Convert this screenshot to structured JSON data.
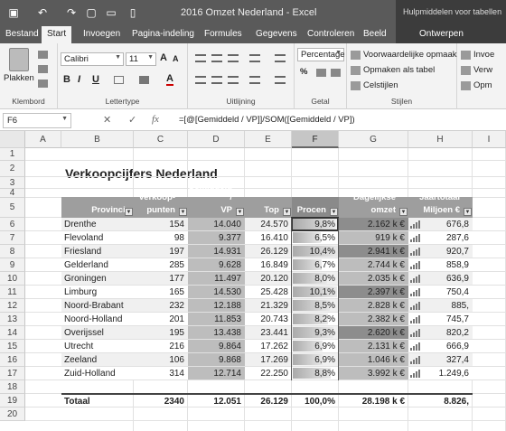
{
  "window": {
    "title": "2016 Omzet Nederland  -  Excel",
    "context_group": "Hulpmiddelen voor tabellen"
  },
  "quick_access": [
    "save-icon",
    "undo-icon",
    "redo-icon",
    "new-icon",
    "open-icon",
    "print-preview-icon"
  ],
  "tabs": [
    "Bestand",
    "Start",
    "Invoegen",
    "Pagina-indeling",
    "Formules",
    "Gegevens",
    "Controleren",
    "Beeld"
  ],
  "active_tab": "Start",
  "context_tab": "Ontwerpen",
  "ribbon": {
    "clipboard": {
      "paste": "Plakken",
      "label": "Klembord"
    },
    "font": {
      "name": "Calibri",
      "size": "11",
      "label": "Lettertype",
      "bold": "B",
      "italic": "I",
      "underline": "U",
      "grow": "A",
      "shrink": "A",
      "fill": "A"
    },
    "alignment": {
      "label": "Uitlijning"
    },
    "number": {
      "format": "Percentage",
      "label": "Getal",
      "percent": "%"
    },
    "styles": {
      "cond": "Voorwaardelijke opmaak",
      "table": "Opmaken als tabel",
      "cell": "Celstijlen",
      "label": "Stijlen"
    },
    "cells": {
      "insert": "Invoe",
      "delete": "Verw",
      "format": "Opm"
    }
  },
  "formula_bar": {
    "name_box": "F6",
    "fx": "fx",
    "cancel": "✕",
    "enter": "✓",
    "formula": "=[@[Gemiddeld / VP]]/SOM([Gemiddeld / VP])"
  },
  "columns": [
    "A",
    "B",
    "C",
    "D",
    "E",
    "F",
    "G",
    "H",
    "I"
  ],
  "selected_column": "F",
  "rows": [
    "1",
    "2",
    "3",
    "4",
    "5",
    "6",
    "7",
    "8",
    "9",
    "10",
    "11",
    "12",
    "13",
    "14",
    "15",
    "16",
    "17",
    "18",
    "19",
    "20"
  ],
  "sheet_title": "Verkoopcijfers Nederland",
  "headers": {
    "provincie": "Provincie",
    "verkooppunten": [
      "Verkoop-",
      "punten"
    ],
    "gemiddeld": [
      "Gemiddeld /",
      "VP"
    ],
    "top": "Top",
    "procent": "Procen",
    "dagelijkse": [
      "Dagelijkse",
      "omzet"
    ],
    "jaartotaal": [
      "Jaartotaal",
      "Miljoen €"
    ]
  },
  "table": [
    {
      "provincie": "Drenthe",
      "vp": "154",
      "gem": "14.040",
      "top": "24.570",
      "pct": "9,8%",
      "pct_value": 9.8,
      "dag": "2.162 k €",
      "jaar": "676,8"
    },
    {
      "provincie": "Flevoland",
      "vp": "98",
      "gem": "9.377",
      "top": "16.410",
      "pct": "6,5%",
      "pct_value": 6.5,
      "dag": "919 k €",
      "jaar": "287,6"
    },
    {
      "provincie": "Friesland",
      "vp": "197",
      "gem": "14.931",
      "top": "26.129",
      "pct": "10,4%",
      "pct_value": 10.4,
      "dag": "2.941 k €",
      "jaar": "920,7"
    },
    {
      "provincie": "Gelderland",
      "vp": "285",
      "gem": "9.628",
      "top": "16.849",
      "pct": "6,7%",
      "pct_value": 6.7,
      "dag": "2.744 k €",
      "jaar": "858,9"
    },
    {
      "provincie": "Groningen",
      "vp": "177",
      "gem": "11.497",
      "top": "20.120",
      "pct": "8,0%",
      "pct_value": 8.0,
      "dag": "2.035 k €",
      "jaar": "636,9"
    },
    {
      "provincie": "Limburg",
      "vp": "165",
      "gem": "14.530",
      "top": "25.428",
      "pct": "10,1%",
      "pct_value": 10.1,
      "dag": "2.397 k €",
      "jaar": "750,4"
    },
    {
      "provincie": "Noord-Brabant",
      "vp": "232",
      "gem": "12.188",
      "top": "21.329",
      "pct": "8,5%",
      "pct_value": 8.5,
      "dag": "2.828 k €",
      "jaar": "885,"
    },
    {
      "provincie": "Noord-Holland",
      "vp": "201",
      "gem": "11.853",
      "top": "20.743",
      "pct": "8,2%",
      "pct_value": 8.2,
      "dag": "2.382 k €",
      "jaar": "745,7"
    },
    {
      "provincie": "Overijssel",
      "vp": "195",
      "gem": "13.438",
      "top": "23.441",
      "pct": "9,3%",
      "pct_value": 9.3,
      "dag": "2.620 k €",
      "jaar": "820,2"
    },
    {
      "provincie": "Utrecht",
      "vp": "216",
      "gem": "9.864",
      "top": "17.262",
      "pct": "6,9%",
      "pct_value": 6.9,
      "dag": "2.131 k €",
      "jaar": "666,9"
    },
    {
      "provincie": "Zeeland",
      "vp": "106",
      "gem": "9.868",
      "top": "17.269",
      "pct": "6,9%",
      "pct_value": 6.9,
      "dag": "1.046 k €",
      "jaar": "327,4"
    },
    {
      "provincie": "Zuid-Holland",
      "vp": "314",
      "gem": "12.714",
      "top": "22.250",
      "pct": "8,8%",
      "pct_value": 8.8,
      "dag": "3.992 k €",
      "jaar": "1.249,6"
    }
  ],
  "totals": {
    "label": "Totaal",
    "vp": "2340",
    "gem": "12.051",
    "top": "26.129",
    "pct": "100,0%",
    "dag": "28.198 k €",
    "jaar": "8.826,"
  }
}
